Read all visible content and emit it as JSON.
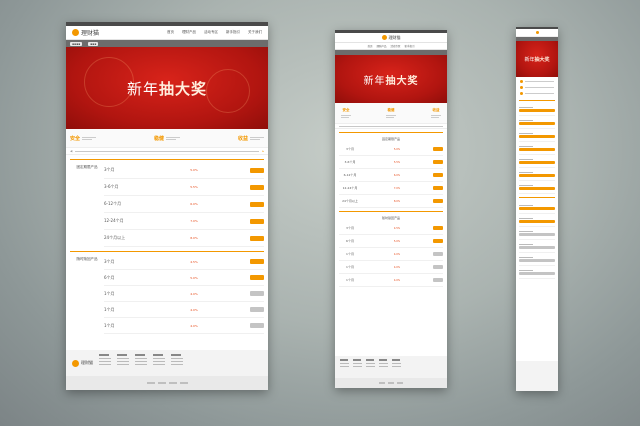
{
  "brand": {
    "name": "理财猫",
    "accent": "#f39800",
    "banner_red": "#c81d16"
  },
  "nav": [
    "首页",
    "理财产品",
    "活动专区",
    "新手指引",
    "关于我们"
  ],
  "banner": {
    "title_prefix": "新年",
    "title_main": "抽大奖"
  },
  "features": [
    {
      "name": "安全"
    },
    {
      "name": "稳健"
    },
    {
      "name": "收益"
    }
  ],
  "sections": [
    {
      "label": "固定期限产品",
      "rows": [
        {
          "term": "3个月",
          "rate": "5.0%",
          "enabled": true
        },
        {
          "term": "3-6个月",
          "rate": "5.5%",
          "enabled": true
        },
        {
          "term": "6-12个月",
          "rate": "6.0%",
          "enabled": true
        },
        {
          "term": "12-24个月",
          "rate": "7.0%",
          "enabled": true
        },
        {
          "term": "24个月以上",
          "rate": "8.0%",
          "enabled": true
        }
      ]
    },
    {
      "label": "随时赎回产品",
      "rows": [
        {
          "term": "3个月",
          "rate": "4.5%",
          "enabled": true
        },
        {
          "term": "6个月",
          "rate": "5.0%",
          "enabled": true
        },
        {
          "term": "1个月",
          "rate": "4.0%",
          "enabled": false
        },
        {
          "term": "1个月",
          "rate": "4.0%",
          "enabled": false
        },
        {
          "term": "1个月",
          "rate": "4.0%",
          "enabled": false
        }
      ]
    }
  ]
}
